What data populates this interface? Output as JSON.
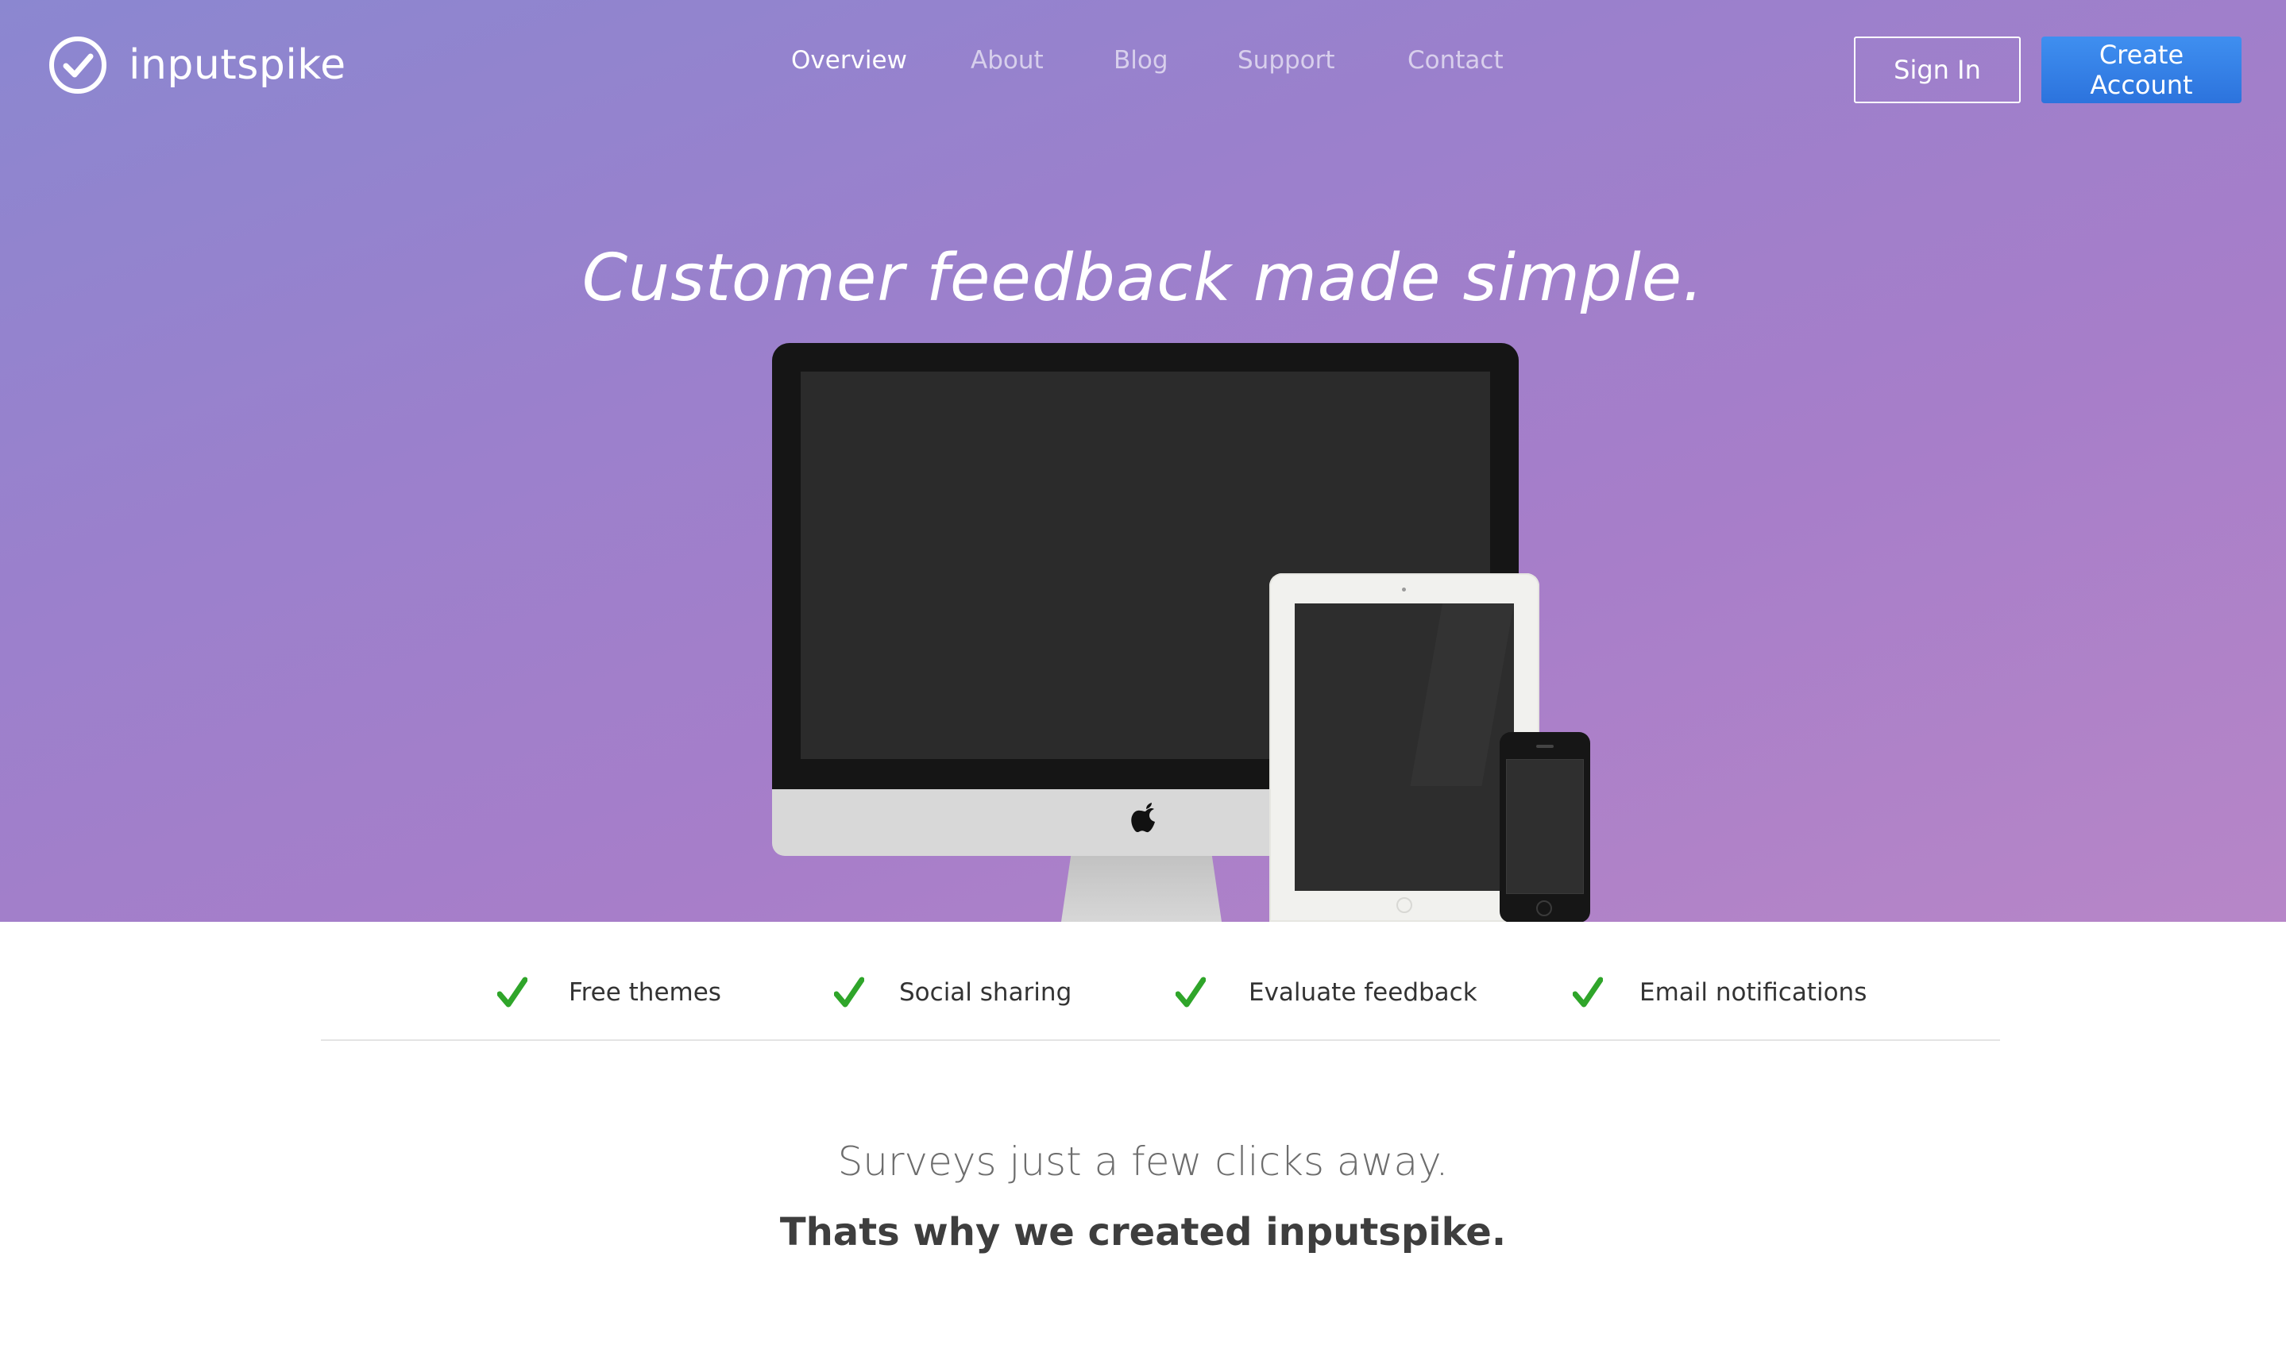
{
  "brand": {
    "name": "inputspike",
    "logo_icon": "check-circle-icon"
  },
  "nav": {
    "items": [
      {
        "label": "Overview",
        "active": true
      },
      {
        "label": "About",
        "active": false
      },
      {
        "label": "Blog",
        "active": false
      },
      {
        "label": "Support",
        "active": false
      },
      {
        "label": "Contact",
        "active": false
      }
    ]
  },
  "auth": {
    "signin_label": "Sign In",
    "create_label": "Create Account"
  },
  "hero": {
    "headline": "Customer feedback made simple.",
    "devices": [
      "imac",
      "ipad",
      "iphone"
    ]
  },
  "features": {
    "icon": "check-icon",
    "items": [
      {
        "label": "Free themes"
      },
      {
        "label": "Social sharing"
      },
      {
        "label": "Evaluate feedback"
      },
      {
        "label": "Email notifications"
      }
    ]
  },
  "intro": {
    "tagline": "Surveys just a few clicks away.",
    "subtag": "Thats why we created inputspike."
  },
  "colors": {
    "hero_gradient_start": "#8b87d0",
    "hero_gradient_end": "#b786c8",
    "primary_button": "#2f7be3",
    "check_green": "#2fa52a"
  }
}
